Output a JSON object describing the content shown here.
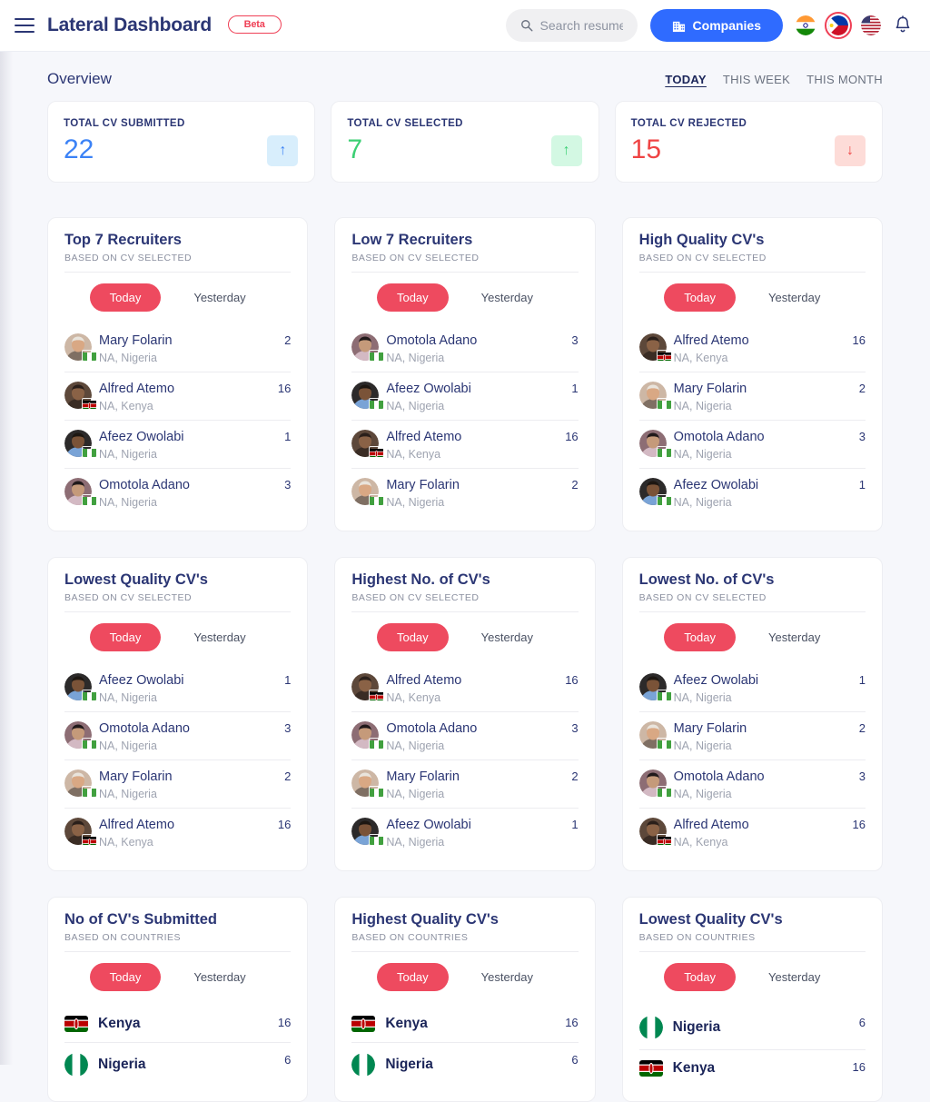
{
  "header": {
    "brand": "Lateral Dashboard",
    "badge": "Beta",
    "search_placeholder": "Search resume",
    "companies_label": "Companies",
    "flags": [
      {
        "name": "india",
        "selected": false
      },
      {
        "name": "philippines",
        "selected": true
      },
      {
        "name": "usa",
        "selected": false
      }
    ]
  },
  "overview": {
    "title": "Overview",
    "periods": [
      {
        "label": "TODAY",
        "active": true
      },
      {
        "label": "THIS WEEK",
        "active": false
      },
      {
        "label": "THIS MONTH",
        "active": false
      }
    ],
    "stats": [
      {
        "label": "TOTAL CV SUBMITTED",
        "value": "22",
        "color": "blue",
        "trend": "up"
      },
      {
        "label": "TOTAL CV SELECTED",
        "value": "7",
        "color": "green",
        "trend": "up"
      },
      {
        "label": "TOTAL CV REJECTED",
        "value": "15",
        "color": "red",
        "trend": "down"
      }
    ]
  },
  "toggle": {
    "today": "Today",
    "yesterday": "Yesterday"
  },
  "panels": [
    {
      "title": "Top 7 Recruiters",
      "subtitle": "BASED ON CV SELECTED",
      "kind": "people",
      "rows": [
        {
          "name": "Mary Folarin",
          "location": "NA, Nigeria",
          "count": "2",
          "country": "nigeria",
          "avatar": "mary"
        },
        {
          "name": "Alfred Atemo",
          "location": "NA, Kenya",
          "count": "16",
          "country": "kenya",
          "avatar": "alfred"
        },
        {
          "name": "Afeez Owolabi",
          "location": "NA, Nigeria",
          "count": "1",
          "country": "nigeria",
          "avatar": "afeez"
        },
        {
          "name": "Omotola Adano",
          "location": "NA, Nigeria",
          "count": "3",
          "country": "nigeria",
          "avatar": "omotola"
        }
      ]
    },
    {
      "title": "Low 7 Recruiters",
      "subtitle": "BASED ON CV SELECTED",
      "kind": "people",
      "rows": [
        {
          "name": "Omotola Adano",
          "location": "NA, Nigeria",
          "count": "3",
          "country": "nigeria",
          "avatar": "omotola"
        },
        {
          "name": "Afeez Owolabi",
          "location": "NA, Nigeria",
          "count": "1",
          "country": "nigeria",
          "avatar": "afeez"
        },
        {
          "name": "Alfred Atemo",
          "location": "NA, Kenya",
          "count": "16",
          "country": "kenya",
          "avatar": "alfred"
        },
        {
          "name": "Mary Folarin",
          "location": "NA, Nigeria",
          "count": "2",
          "country": "nigeria",
          "avatar": "mary"
        }
      ]
    },
    {
      "title": "High Quality CV's",
      "subtitle": "BASED ON CV SELECTED",
      "kind": "people",
      "rows": [
        {
          "name": "Alfred Atemo",
          "location": "NA, Kenya",
          "count": "16",
          "country": "kenya",
          "avatar": "alfred"
        },
        {
          "name": "Mary Folarin",
          "location": "NA, Nigeria",
          "count": "2",
          "country": "nigeria",
          "avatar": "mary"
        },
        {
          "name": "Omotola Adano",
          "location": "NA, Nigeria",
          "count": "3",
          "country": "nigeria",
          "avatar": "omotola"
        },
        {
          "name": "Afeez Owolabi",
          "location": "NA, Nigeria",
          "count": "1",
          "country": "nigeria",
          "avatar": "afeez"
        }
      ]
    },
    {
      "title": "Lowest Quality CV's",
      "subtitle": "BASED ON CV SELECTED",
      "kind": "people",
      "rows": [
        {
          "name": "Afeez Owolabi",
          "location": "NA, Nigeria",
          "count": "1",
          "country": "nigeria",
          "avatar": "afeez"
        },
        {
          "name": "Omotola Adano",
          "location": "NA, Nigeria",
          "count": "3",
          "country": "nigeria",
          "avatar": "omotola"
        },
        {
          "name": "Mary Folarin",
          "location": "NA, Nigeria",
          "count": "2",
          "country": "nigeria",
          "avatar": "mary"
        },
        {
          "name": "Alfred Atemo",
          "location": "NA, Kenya",
          "count": "16",
          "country": "kenya",
          "avatar": "alfred"
        }
      ]
    },
    {
      "title": "Highest No. of CV's",
      "subtitle": "BASED ON CV SELECTED",
      "kind": "people",
      "rows": [
        {
          "name": "Alfred Atemo",
          "location": "NA, Kenya",
          "count": "16",
          "country": "kenya",
          "avatar": "alfred"
        },
        {
          "name": "Omotola Adano",
          "location": "NA, Nigeria",
          "count": "3",
          "country": "nigeria",
          "avatar": "omotola"
        },
        {
          "name": "Mary Folarin",
          "location": "NA, Nigeria",
          "count": "2",
          "country": "nigeria",
          "avatar": "mary"
        },
        {
          "name": "Afeez Owolabi",
          "location": "NA, Nigeria",
          "count": "1",
          "country": "nigeria",
          "avatar": "afeez"
        }
      ]
    },
    {
      "title": "Lowest No. of CV's",
      "subtitle": "BASED ON CV SELECTED",
      "kind": "people",
      "rows": [
        {
          "name": "Afeez Owolabi",
          "location": "NA, Nigeria",
          "count": "1",
          "country": "nigeria",
          "avatar": "afeez"
        },
        {
          "name": "Mary Folarin",
          "location": "NA, Nigeria",
          "count": "2",
          "country": "nigeria",
          "avatar": "mary"
        },
        {
          "name": "Omotola Adano",
          "location": "NA, Nigeria",
          "count": "3",
          "country": "nigeria",
          "avatar": "omotola"
        },
        {
          "name": "Alfred Atemo",
          "location": "NA, Kenya",
          "count": "16",
          "country": "kenya",
          "avatar": "alfred"
        }
      ]
    },
    {
      "title": "No of CV's Submitted",
      "subtitle": "BASED ON COUNTRIES",
      "kind": "country",
      "rows": [
        {
          "name": "Kenya",
          "count": "16",
          "country": "kenya"
        },
        {
          "name": "Nigeria",
          "count": "6",
          "country": "nigeria"
        }
      ]
    },
    {
      "title": "Highest Quality CV's",
      "subtitle": "BASED ON COUNTRIES",
      "kind": "country",
      "rows": [
        {
          "name": "Kenya",
          "count": "16",
          "country": "kenya"
        },
        {
          "name": "Nigeria",
          "count": "6",
          "country": "nigeria"
        }
      ]
    },
    {
      "title": "Lowest Quality CV's",
      "subtitle": "BASED ON COUNTRIES",
      "kind": "country",
      "rows": [
        {
          "name": "Nigeria",
          "count": "6",
          "country": "nigeria"
        },
        {
          "name": "Kenya",
          "count": "16",
          "country": "kenya"
        }
      ]
    }
  ],
  "colors": {
    "accent_red": "#ee4a5f",
    "brand_blue": "#2f6bff",
    "page_bg": "#f6f7fb",
    "stat_blue": "#3b82f6",
    "stat_green": "#3ccf74",
    "stat_red": "#ef4444"
  }
}
